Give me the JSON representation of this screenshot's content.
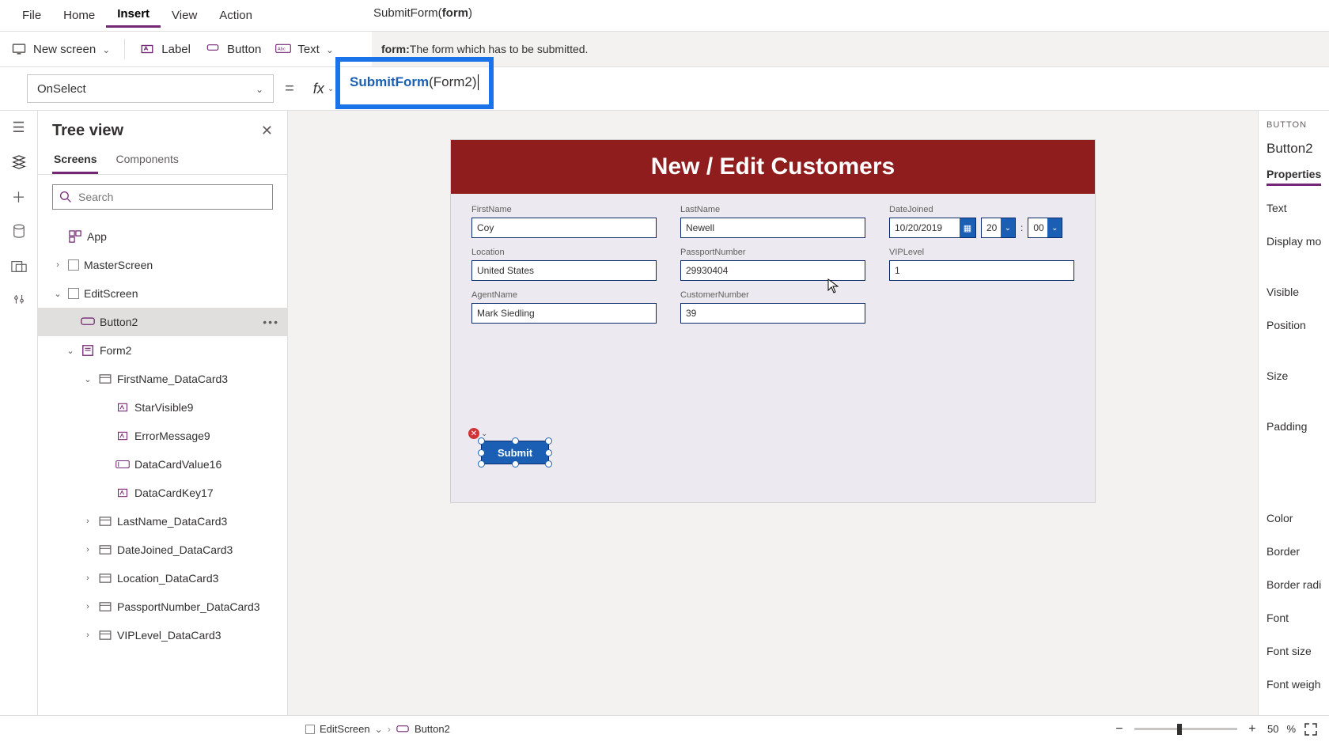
{
  "menu": {
    "file": "File",
    "home": "Home",
    "insert": "Insert",
    "view": "View",
    "action": "Action",
    "active": "Insert"
  },
  "signature": {
    "prefix": "SubmitForm(",
    "bold": "form",
    "suffix": ")"
  },
  "tooltip": {
    "label": "form:",
    "text": " The form which has to be submitted."
  },
  "ribbon": {
    "newScreen": "New screen",
    "label": "Label",
    "button": "Button",
    "text": "Text"
  },
  "formulaBar": {
    "property": "OnSelect",
    "fx": "fx",
    "fn": "SubmitForm",
    "args": "(Form2)"
  },
  "tree": {
    "title": "Tree view",
    "tabs": {
      "screens": "Screens",
      "components": "Components"
    },
    "searchPlaceholder": "Search",
    "nodes": {
      "app": "App",
      "master": "MasterScreen",
      "edit": "EditScreen",
      "button2": "Button2",
      "form2": "Form2",
      "firstNameCard": "FirstName_DataCard3",
      "star": "StarVisible9",
      "err": "ErrorMessage9",
      "dcv": "DataCardValue16",
      "dck": "DataCardKey17",
      "lastNameCard": "LastName_DataCard3",
      "dateCard": "DateJoined_DataCard3",
      "locCard": "Location_DataCard3",
      "ppCard": "PassportNumber_DataCard3",
      "vipCard": "VIPLevel_DataCard3"
    }
  },
  "canvas": {
    "header": "New / Edit Customers",
    "fields": {
      "firstName": {
        "label": "FirstName",
        "value": "Coy"
      },
      "lastName": {
        "label": "LastName",
        "value": "Newell"
      },
      "dateJoined": {
        "label": "DateJoined",
        "value": "10/20/2019",
        "hh": "20",
        "mm": "00"
      },
      "location": {
        "label": "Location",
        "value": "United States"
      },
      "passport": {
        "label": "PassportNumber",
        "value": "29930404"
      },
      "vip": {
        "label": "VIPLevel",
        "value": "1"
      },
      "agent": {
        "label": "AgentName",
        "value": "Mark Siedling"
      },
      "custNo": {
        "label": "CustomerNumber",
        "value": "39"
      }
    },
    "submit": "Submit"
  },
  "propPanel": {
    "caption": "BUTTON",
    "name": "Button2",
    "tab": "Properties",
    "rows": [
      "Text",
      "Display mo",
      "Visible",
      "Position",
      "Size",
      "Padding",
      "Color",
      "Border",
      "Border radi",
      "Font",
      "Font size",
      "Font weigh"
    ]
  },
  "breadcrumb": {
    "screen": "EditScreen",
    "control": "Button2"
  },
  "zoom": {
    "value": "50",
    "pct": "%"
  }
}
